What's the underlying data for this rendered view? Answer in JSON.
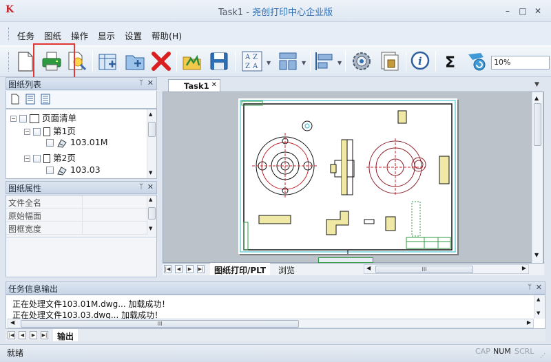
{
  "window": {
    "title_prefix": "Task1 - ",
    "title_app": "尧创打印中心企业版"
  },
  "menu": {
    "items": [
      "任务",
      "图纸",
      "操作",
      "显示",
      "设置",
      "帮助(H)"
    ]
  },
  "toolbar": {
    "zoom_value": "10%",
    "icons": [
      "new-document-icon",
      "print-icon",
      "magic-wand-icon",
      "add-frame-icon",
      "add-folder-icon",
      "delete-icon",
      "open-folder-icon",
      "save-icon",
      "sort-az-icon",
      "layout-icon",
      "align-icon",
      "settings-gear-icon",
      "stamp-icon",
      "info-icon",
      "sum-icon",
      "refresh-icon"
    ]
  },
  "drawing_list": {
    "title": "图纸列表",
    "tree": {
      "root": "页面清单",
      "pages": [
        {
          "label": "第1页",
          "file": "103.01M"
        },
        {
          "label": "第2页",
          "file": "103.03"
        }
      ]
    }
  },
  "drawing_props": {
    "title": "图纸属性",
    "rows": [
      "文件全名",
      "原始幅面",
      "图框宽度"
    ]
  },
  "document": {
    "tab": "Task1",
    "bottom_tabs": [
      "图纸打印/PLT",
      "浏览"
    ]
  },
  "output": {
    "title": "任务信息输出",
    "lines": [
      "正在处理文件103.01M.dwg... 加载成功！",
      "正在处理文件103.03.dwg... 加载成功！"
    ],
    "tab": "输出"
  },
  "status": {
    "text": "就绪",
    "indicators": [
      "CAP",
      "NUM",
      "SCRL"
    ]
  },
  "colors": {
    "highlight": "#e23535",
    "title_app": "#2d6fb6"
  }
}
